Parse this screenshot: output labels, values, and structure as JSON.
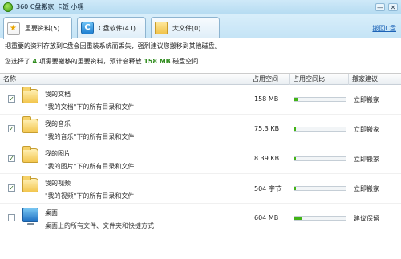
{
  "title": "360 C盘搬家  卡饭 小嘿",
  "window_buttons": [
    "—",
    "✕"
  ],
  "tabs": [
    {
      "label": "重要资料(5)",
      "icon": "document-star-icon",
      "active": true
    },
    {
      "label": "C盘软件(41)",
      "icon": "c-drive-icon",
      "active": false
    },
    {
      "label": "大文件(0)",
      "icon": "folder-icon",
      "active": false
    }
  ],
  "restore_link": "搬回C盘",
  "info": {
    "line1": "把重要的资料存放到C盘会因重装系统而丢失，强烈建议您搬移到其他磁盘。",
    "line2_prefix": "您选择了",
    "line2_count": "4",
    "line2_mid": "项需要搬移的重要资料，预计会释放",
    "line2_size": "158 MB",
    "line2_suffix": "磁盘空间"
  },
  "columns": {
    "name": "名称",
    "size": "占用空间",
    "ratio": "占用空间比",
    "advice": "搬家建议"
  },
  "rows": [
    {
      "checked": true,
      "icon": "folder-icon",
      "name": "我的文档",
      "desc": "\"我的文档\"下的所有目录和文件",
      "size": "158 MB",
      "ratio": 0.08,
      "action": "立即搬家"
    },
    {
      "checked": true,
      "icon": "folder-icon",
      "name": "我的音乐",
      "desc": "\"我的音乐\"下的所有目录和文件",
      "size": "75.3 KB",
      "ratio": 0.03,
      "action": "立即搬家"
    },
    {
      "checked": true,
      "icon": "folder-icon",
      "name": "我的图片",
      "desc": "\"我的图片\"下的所有目录和文件",
      "size": "8.39 KB",
      "ratio": 0.03,
      "action": "立即搬家"
    },
    {
      "checked": true,
      "icon": "folder-icon",
      "name": "我的视频",
      "desc": "\"我的视频\"下的所有目录和文件",
      "size": "504 字节",
      "ratio": 0.03,
      "action": "立即搬家"
    },
    {
      "checked": false,
      "icon": "desktop-icon",
      "name": "桌面",
      "desc": "桌面上的所有文件、文件夹和快捷方式",
      "size": "604 MB",
      "ratio": 0.16,
      "action": "建议保留"
    }
  ],
  "colors": {
    "accent_green": "#41b316",
    "link_blue": "#1c63b7"
  }
}
